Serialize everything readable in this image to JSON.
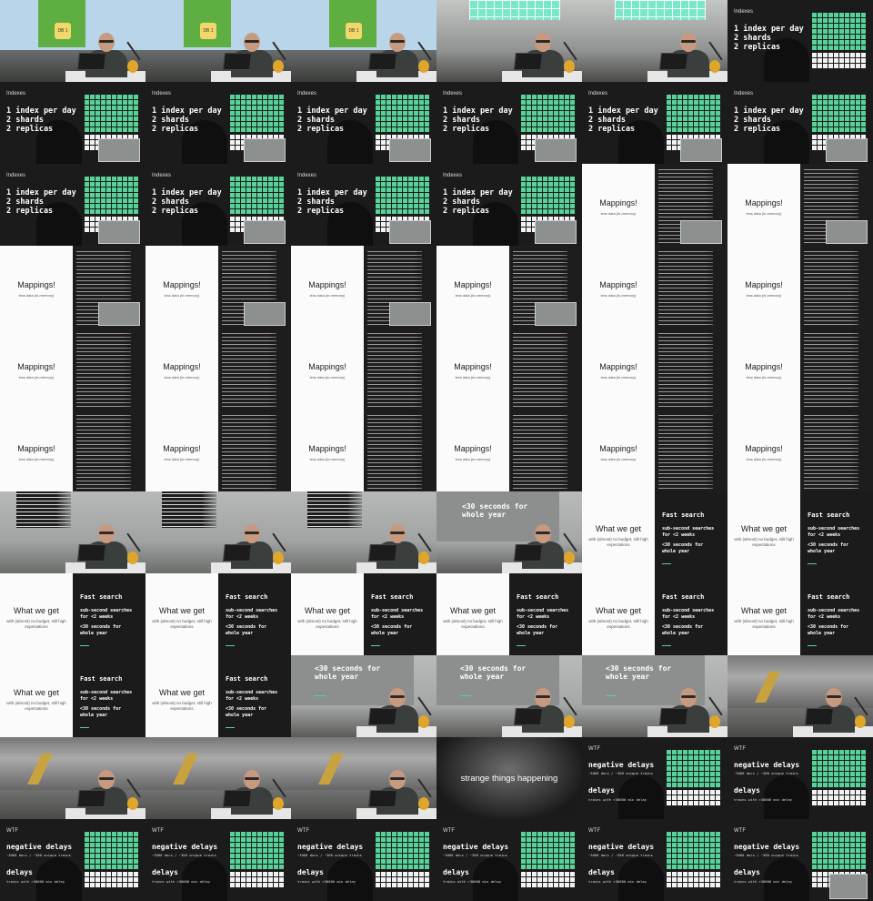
{
  "indexes": {
    "label": "Indexes",
    "lines": [
      "1 index per day",
      "2 shards",
      "2 replicas"
    ]
  },
  "db_label": "DB 1",
  "mappings": {
    "title": "Mappings!",
    "subtitle": "less data (in-memory)"
  },
  "what_we_get": {
    "title": "What we get",
    "subtitle": "with (almost) no budget, still high expectations",
    "heading": "Fast search",
    "line1": "sub-second searches",
    "line2": "for <2 weeks",
    "line3": "<30 seconds for",
    "line4": "whole year"
  },
  "thirty": {
    "line1": "<30 seconds for",
    "line2": "whole year"
  },
  "strange": "strange things happening",
  "wtf": {
    "label": "WTF",
    "line1": "negative delays",
    "sub1": "~3000 docs / ~300 unique trains",
    "line2": "delays",
    "sub2": "trains with >30000 min delay"
  },
  "colors": {
    "accent_green": "#57d39a",
    "dark_bg": "#1b1b1b",
    "light_bg": "#fbfbfb"
  },
  "tiles": [
    "blue",
    "blue",
    "blue",
    "window",
    "window",
    "indexes",
    "indexes",
    "indexes",
    "indexes",
    "indexes",
    "indexes",
    "indexes",
    "indexes",
    "indexes",
    "indexes",
    "indexes",
    "mappings",
    "mappings",
    "mappings",
    "mappings",
    "mappings",
    "mappings",
    "mappings",
    "mappings",
    "mappings",
    "mappings",
    "mappings",
    "mappings",
    "mappings",
    "mappings",
    "mappings",
    "mappings",
    "mappings",
    "mappings",
    "mappings",
    "mappings",
    "code-speaker",
    "code-speaker",
    "code-speaker",
    "thirty-speaker",
    "wwg",
    "wwg",
    "wwg",
    "wwg",
    "wwg",
    "wwg",
    "wwg",
    "wwg",
    "wwg",
    "wwg",
    "thirty",
    "thirty",
    "thirty",
    "station",
    "station",
    "station",
    "station",
    "strange",
    "wtf",
    "wtf",
    "wtf",
    "wtf",
    "wtf",
    "wtf",
    "wtf",
    "wtf"
  ]
}
